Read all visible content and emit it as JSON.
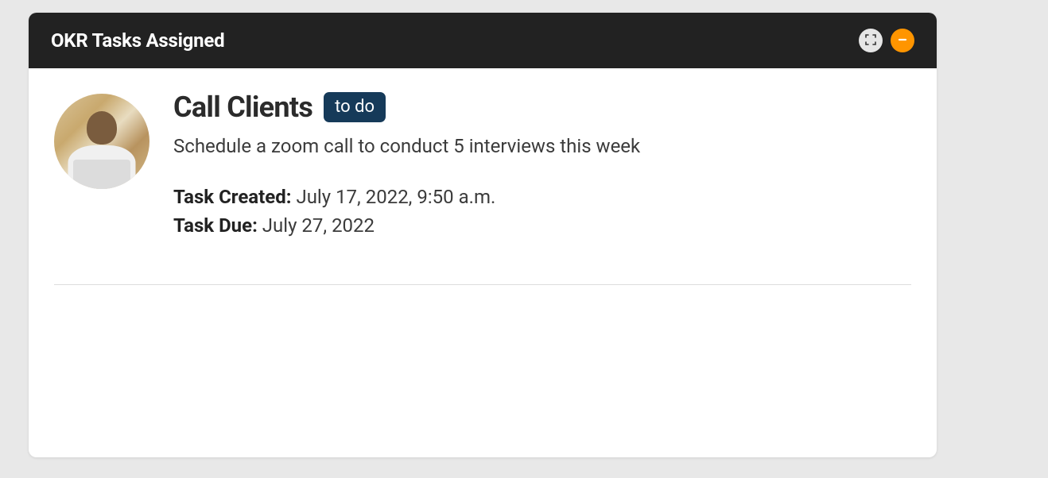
{
  "card": {
    "title": "OKR Tasks Assigned"
  },
  "task": {
    "title": "Call Clients",
    "status": "to do",
    "description": "Schedule a zoom call to conduct 5 interviews this week",
    "created_label": "Task Created:",
    "created_value": "July 17, 2022, 9:50 a.m.",
    "due_label": "Task Due:",
    "due_value": "July 27, 2022"
  },
  "colors": {
    "header_bg": "#222222",
    "accent": "#ff9500",
    "badge": "#163a59"
  }
}
